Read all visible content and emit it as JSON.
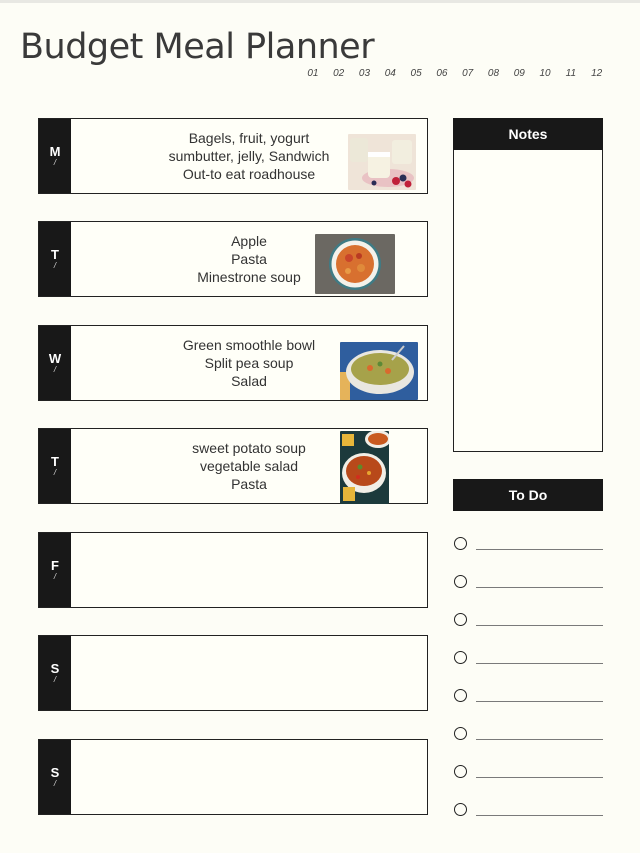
{
  "title": "Budget Meal Planner",
  "months": [
    "01",
    "02",
    "03",
    "04",
    "05",
    "06",
    "07",
    "08",
    "09",
    "10",
    "11",
    "12"
  ],
  "days": [
    {
      "letter": "M",
      "slash": "/",
      "meals": [
        "Bagels, fruit, yogurt",
        "sumbutter, jelly, Sandwich",
        "Out-to eat roadhouse"
      ],
      "image": "yogurt-jars-with-berries"
    },
    {
      "letter": "T",
      "slash": "/",
      "meals": [
        "Apple",
        "Pasta",
        "Minestrone soup"
      ],
      "image": "plate-of-pasta"
    },
    {
      "letter": "W",
      "slash": "/",
      "meals": [
        "Green smoothle bowl",
        "Split  pea soup",
        "Salad"
      ],
      "image": "bowl-of-split-pea-soup"
    },
    {
      "letter": "T",
      "slash": "/",
      "meals": [
        "sweet potato soup",
        "vegetable  salad",
        "Pasta"
      ],
      "image": "bowls-of-vegetable-soup"
    },
    {
      "letter": "F",
      "slash": "/",
      "meals": [],
      "image": null
    },
    {
      "letter": "S",
      "slash": "/",
      "meals": [],
      "image": null
    },
    {
      "letter": "S",
      "slash": "/",
      "meals": [],
      "image": null
    }
  ],
  "notes": {
    "label": "Notes",
    "content": ""
  },
  "todo": {
    "label": "To Do",
    "items": [
      "",
      "",
      "",
      "",
      "",
      "",
      "",
      ""
    ]
  },
  "colors": {
    "background": "#fdfdf6",
    "header_fill": "#181818",
    "text": "#333333"
  }
}
